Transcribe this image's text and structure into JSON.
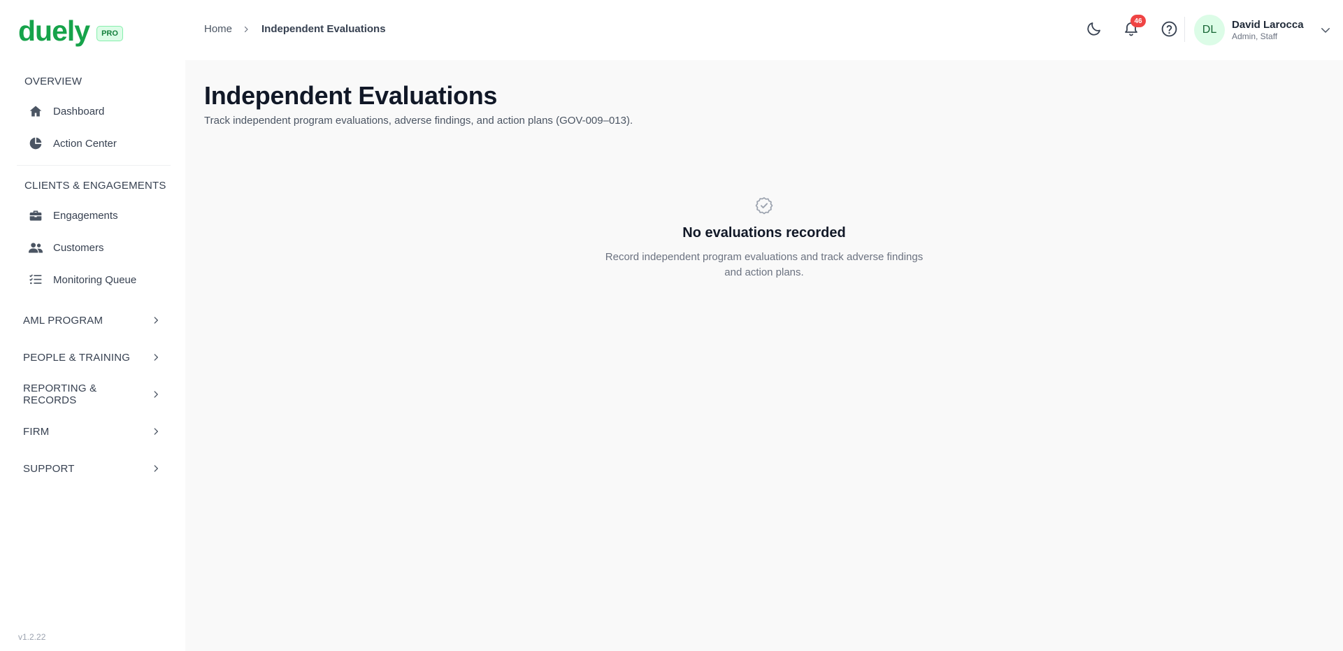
{
  "brand": {
    "name": "duely",
    "badge": "PRO",
    "accent": "#16a34a"
  },
  "sidebar": {
    "sections": [
      {
        "heading": "OVERVIEW",
        "items": [
          {
            "label": "Dashboard",
            "icon": "home-icon"
          },
          {
            "label": "Action Center",
            "icon": "pie-chart-icon"
          }
        ]
      },
      {
        "heading": "CLIENTS & ENGAGEMENTS",
        "items": [
          {
            "label": "Engagements",
            "icon": "briefcase-icon"
          },
          {
            "label": "Customers",
            "icon": "users-icon"
          },
          {
            "label": "Monitoring Queue",
            "icon": "checklist-icon"
          }
        ]
      }
    ],
    "groups": [
      {
        "label": "AML PROGRAM"
      },
      {
        "label": "PEOPLE & TRAINING"
      },
      {
        "label": "REPORTING & RECORDS"
      },
      {
        "label": "FIRM"
      },
      {
        "label": "SUPPORT"
      }
    ],
    "version": "v1.2.22"
  },
  "topbar": {
    "breadcrumb": {
      "home": "Home",
      "current": "Independent Evaluations"
    },
    "notifications_count": "46",
    "user": {
      "initials": "DL",
      "name": "David Larocca",
      "role": "Admin, Staff"
    }
  },
  "main": {
    "title": "Independent Evaluations",
    "subtitle": "Track independent program evaluations, adverse findings, and action plans (GOV-009–013).",
    "empty_state": {
      "icon": "badge-check-icon",
      "title": "No evaluations recorded",
      "description": "Record independent program evaluations and track adverse findings and action plans."
    }
  }
}
